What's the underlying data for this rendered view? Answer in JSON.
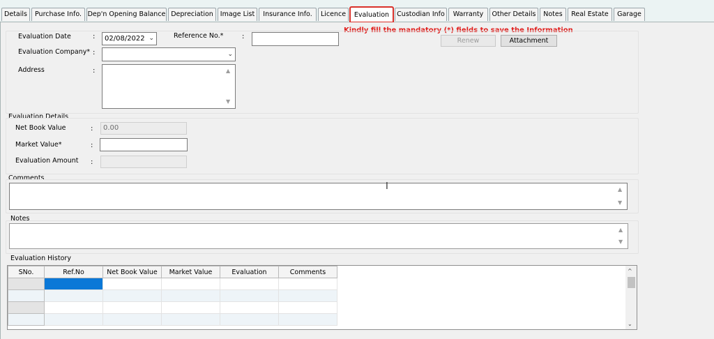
{
  "tabs": [
    {
      "label": "Details"
    },
    {
      "label": "Purchase Info."
    },
    {
      "label": "Dep'n Opening Balance"
    },
    {
      "label": "Depreciation"
    },
    {
      "label": "Image List"
    },
    {
      "label": "Insurance Info."
    },
    {
      "label": "Licence"
    },
    {
      "label": "Evaluation",
      "active": true
    },
    {
      "label": "Custodian Info"
    },
    {
      "label": "Warranty"
    },
    {
      "label": "Other Details"
    },
    {
      "label": "Notes"
    },
    {
      "label": "Real Estate"
    },
    {
      "label": "Garage"
    }
  ],
  "warning": "Kindly fill the mandatory (*) fields to save the Information",
  "form": {
    "evaluation_date_label": "Evaluation Date",
    "evaluation_date_value": "02/08/2022",
    "reference_label": "Reference No.*",
    "reference_value": "",
    "company_label": "Evaluation Company*",
    "company_value": "",
    "address_label": "Address",
    "address_value": "",
    "colon": ":",
    "renew_label": "Renew",
    "attachment_label": "Attachment"
  },
  "evaluation_details": {
    "title": "Evaluation Details",
    "net_book_label": "Net Book Value",
    "net_book_value": "0.00",
    "market_label": "Market Value*",
    "market_value": "",
    "amount_label": "Evaluation Amount",
    "amount_value": ""
  },
  "comments": {
    "label": "Comments",
    "value": ""
  },
  "notes": {
    "label": "Notes",
    "value": ""
  },
  "history": {
    "title": "Evaluation History",
    "columns": [
      "SNo.",
      "Ref.No",
      "Net Book Value",
      "Market Value",
      "Evaluation",
      "Comments"
    ],
    "row_count": 4
  },
  "icons": {
    "dropdown": "chevron-down-icon",
    "scroll_up": "scroll-up-icon",
    "scroll_down": "scroll-down-icon"
  }
}
